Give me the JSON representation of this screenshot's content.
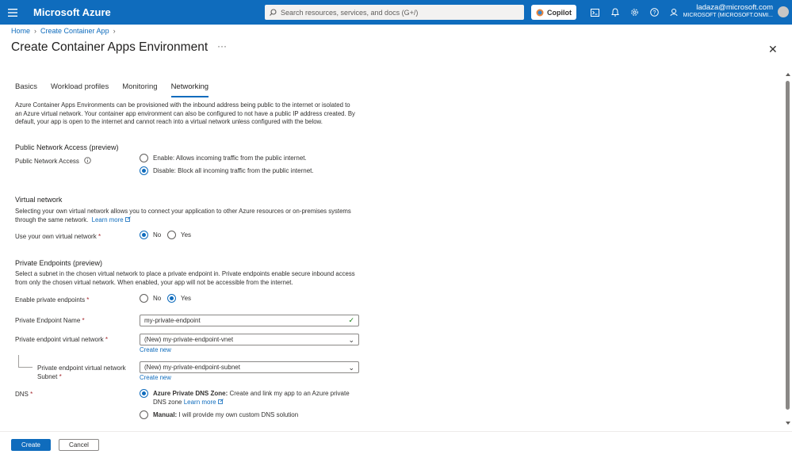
{
  "topbar": {
    "brand": "Microsoft Azure",
    "search_placeholder": "Search resources, services, and docs (G+/)",
    "copilot_label": "Copilot",
    "user": "ladaza@microsoft.com",
    "tenant": "MICROSOFT (MICROSOFT.ONMI...",
    "icons": [
      "cloud-shell-icon",
      "notifications-icon",
      "settings-icon",
      "help-icon",
      "feedback-icon"
    ]
  },
  "breadcrumb": [
    "Home",
    "Create Container App"
  ],
  "page_title": "Create Container Apps Environment",
  "more_label": "···",
  "close_label": "✕",
  "tabs": [
    {
      "label": "Basics",
      "active": false
    },
    {
      "label": "Workload profiles",
      "active": false
    },
    {
      "label": "Monitoring",
      "active": false
    },
    {
      "label": "Networking",
      "active": true
    }
  ],
  "intro": "Azure Container Apps Environments can be provisioned with the inbound address being public to the internet or isolated to an Azure virtual network. Your container app environment can also be configured to not have a public IP address created. By default, your app is open to the internet and cannot reach into a virtual network unless configured with the below.",
  "public_access": {
    "heading": "Public Network Access (preview)",
    "label": "Public Network Access",
    "option_enable": "Enable: Allows incoming traffic from the public internet.",
    "option_disable": "Disable: Block all incoming traffic from the public internet.",
    "selected": "disable"
  },
  "vnet": {
    "heading": "Virtual network",
    "description": "Selecting your own virtual network allows you to connect your application to other Azure resources or on-premises systems through the same network.",
    "learn_more": "Learn more",
    "label": "Use your own virtual network",
    "option_no": "No",
    "option_yes": "Yes",
    "selected": "no"
  },
  "private_endpoints": {
    "heading": "Private Endpoints (preview)",
    "description": "Select a subnet in the chosen virtual network to place a private endpoint in. Private endpoints enable secure inbound access from only the chosen virtual network. When enabled, your app will not be accessible from the internet.",
    "enable_label": "Enable private endpoints",
    "option_no": "No",
    "option_yes": "Yes",
    "selected": "yes",
    "name_label": "Private Endpoint Name",
    "name_value": "my-private-endpoint",
    "vnet_label": "Private endpoint virtual network",
    "vnet_value": "(New) my-private-endpoint-vnet",
    "create_new": "Create new",
    "subnet_label_1": "Private endpoint virtual network",
    "subnet_label_2": "Subnet",
    "subnet_value": "(New) my-private-endpoint-subnet",
    "dns_label": "DNS",
    "dns_option_1_bold": "Azure Private DNS Zone:",
    "dns_option_1_text": "Create and link my app to an Azure private",
    "dns_option_1_text2": "DNS zone",
    "dns_learn_more": "Learn more",
    "dns_option_2_bold": "Manual:",
    "dns_option_2_text": "I will provide my own custom DNS solution",
    "dns_selected": "azure"
  },
  "footer": {
    "create": "Create",
    "cancel": "Cancel"
  },
  "colors": {
    "accent": "#0f6cbd",
    "required": "#a4262c"
  }
}
